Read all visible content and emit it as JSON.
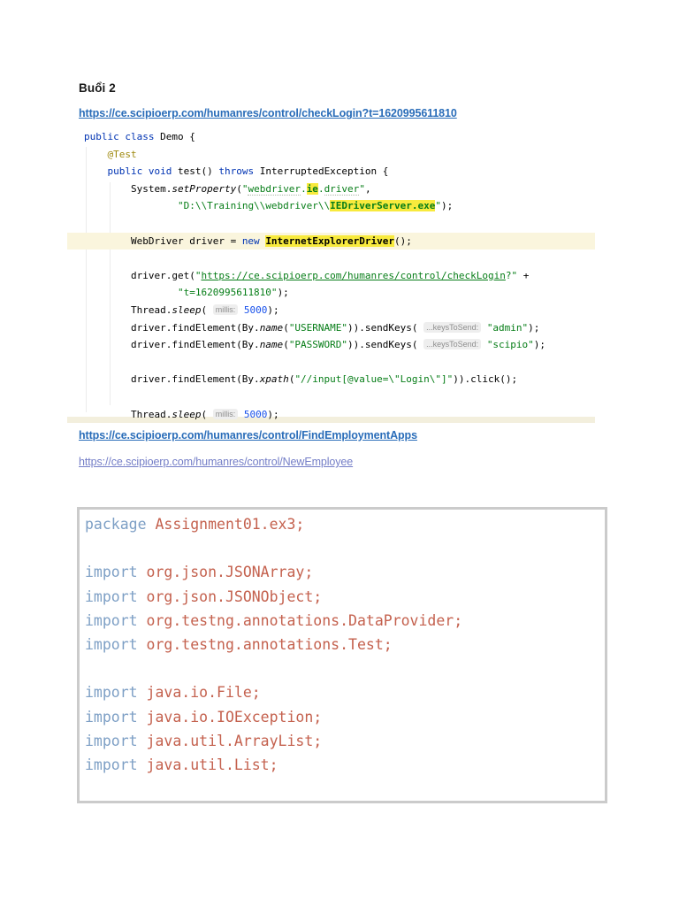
{
  "page": {
    "title": "Buổi 2",
    "links": [
      {
        "text": "https://ce.scipioerp.com/humanres/control/checkLogin?t=1620995611810"
      },
      {
        "text": "https://ce.scipioerp.com/humanres/control/FindEmploymentApps"
      },
      {
        "text": "https://ce.scipioerp.com/humanres/control/NewEmployee"
      }
    ]
  },
  "colors": {
    "link_primary": "#2a6db9",
    "link_visited": "#747ec7",
    "keyword_blue": "#0033b3",
    "string_green": "#067d17",
    "number_blue": "#1750eb",
    "annotation_olive": "#9e880d",
    "highlight_yellow": "#f8ea3d",
    "current_line_cream": "#faf5dd",
    "box_keyword_blue": "#7d9fc5",
    "box_identifier_salmon": "#c4614e",
    "box_border_gray": "#cbcbcb"
  },
  "ide_code": {
    "lines": [
      {
        "seg": [
          [
            "k",
            "public class"
          ],
          [
            "d",
            " Demo {"
          ]
        ]
      },
      {
        "seg": [
          [
            "d",
            "    "
          ],
          [
            "a",
            "@Test"
          ]
        ]
      },
      {
        "seg": [
          [
            "d",
            "    "
          ],
          [
            "k",
            "public void"
          ],
          [
            "d",
            " test() "
          ],
          [
            "k",
            "throws"
          ],
          [
            "d",
            " InterruptedException {"
          ]
        ]
      },
      {
        "seg": [
          [
            "d",
            "        System."
          ],
          [
            "m",
            "setProperty"
          ],
          [
            "d",
            "("
          ],
          [
            "s",
            "\""
          ],
          [
            "sd",
            "webdriver"
          ],
          [
            "s",
            "."
          ],
          [
            "sy",
            "ie"
          ],
          [
            "s",
            "."
          ],
          [
            "sd",
            "driver"
          ],
          [
            "s",
            "\""
          ],
          [
            "d",
            ","
          ]
        ]
      },
      {
        "seg": [
          [
            "d",
            "                "
          ],
          [
            "s",
            "\"D:\\\\Training\\\\webdriver\\\\"
          ],
          [
            "sy",
            "IEDriverServer.exe"
          ],
          [
            "s",
            "\""
          ],
          [
            "d",
            ");"
          ]
        ]
      },
      {
        "seg": []
      },
      {
        "hl": "cream",
        "seg": [
          [
            "d",
            "        WebDriver driver = "
          ],
          [
            "k",
            "new"
          ],
          [
            "d",
            " "
          ],
          [
            "dy",
            "InternetExplorerDriver"
          ],
          [
            "d",
            "();"
          ]
        ]
      },
      {
        "seg": []
      },
      {
        "seg": [
          [
            "d",
            "        driver.get("
          ],
          [
            "s",
            "\""
          ],
          [
            "su",
            "https://ce.scipioerp.com/humanres/control/checkLogin"
          ],
          [
            "s",
            "?\""
          ],
          [
            "d",
            " +"
          ]
        ]
      },
      {
        "seg": [
          [
            "d",
            "                "
          ],
          [
            "s",
            "\"t=1620995611810\""
          ],
          [
            "d",
            ");"
          ]
        ]
      },
      {
        "seg": [
          [
            "d",
            "        Thread."
          ],
          [
            "m",
            "sleep"
          ],
          [
            "d",
            "( "
          ],
          [
            "h",
            "millis:"
          ],
          [
            "d",
            " "
          ],
          [
            "n",
            "5000"
          ],
          [
            "d",
            ");"
          ]
        ]
      },
      {
        "seg": [
          [
            "d",
            "        driver.findElement(By."
          ],
          [
            "m",
            "name"
          ],
          [
            "d",
            "("
          ],
          [
            "s",
            "\"USERNAME\""
          ],
          [
            "d",
            ")).sendKeys( "
          ],
          [
            "h",
            "...keysToSend:"
          ],
          [
            "d",
            " "
          ],
          [
            "s",
            "\"admin\""
          ],
          [
            "d",
            ");"
          ]
        ]
      },
      {
        "seg": [
          [
            "d",
            "        driver.findElement(By."
          ],
          [
            "m",
            "name"
          ],
          [
            "d",
            "("
          ],
          [
            "s",
            "\"PASSWORD\""
          ],
          [
            "d",
            ")).sendKeys( "
          ],
          [
            "h",
            "...keysToSend:"
          ],
          [
            "d",
            " "
          ],
          [
            "s",
            "\"scipio\""
          ],
          [
            "d",
            ");"
          ]
        ]
      },
      {
        "seg": []
      },
      {
        "seg": [
          [
            "d",
            "        driver.findElement(By."
          ],
          [
            "m",
            "xpath"
          ],
          [
            "d",
            "("
          ],
          [
            "s",
            "\"//input[@value=\\\"Login\\\"]\""
          ],
          [
            "d",
            ")).click();"
          ]
        ]
      },
      {
        "seg": []
      },
      {
        "seg": [
          [
            "d",
            "        Thread."
          ],
          [
            "m",
            "sleep"
          ],
          [
            "d",
            "( "
          ],
          [
            "h",
            "millis:"
          ],
          [
            "d",
            " "
          ],
          [
            "n",
            "5000"
          ],
          [
            "d",
            ");"
          ]
        ]
      }
    ]
  },
  "box_code": {
    "lines": [
      {
        "seg": [
          [
            "k2",
            "package"
          ],
          [
            "r2",
            " Assignment01.ex3;"
          ]
        ]
      },
      {
        "seg": []
      },
      {
        "seg": [
          [
            "k2",
            "import"
          ],
          [
            "r2",
            " org.json.JSONArray;"
          ]
        ]
      },
      {
        "seg": [
          [
            "k2",
            "import"
          ],
          [
            "r2",
            " org.json.JSONObject;"
          ]
        ]
      },
      {
        "seg": [
          [
            "k2",
            "import"
          ],
          [
            "r2",
            " org.testng.annotations.DataProvider;"
          ]
        ]
      },
      {
        "seg": [
          [
            "k2",
            "import"
          ],
          [
            "r2",
            " org.testng.annotations.Test;"
          ]
        ]
      },
      {
        "seg": []
      },
      {
        "seg": [
          [
            "k2",
            "import"
          ],
          [
            "r2",
            " java.io.File;"
          ]
        ]
      },
      {
        "seg": [
          [
            "k2",
            "import"
          ],
          [
            "r2",
            " java.io.IOException;"
          ]
        ]
      },
      {
        "seg": [
          [
            "k2",
            "import"
          ],
          [
            "r2",
            " java.util.ArrayList;"
          ]
        ]
      },
      {
        "seg": [
          [
            "k2",
            "import"
          ],
          [
            "r2",
            " java.util.List;"
          ]
        ]
      }
    ]
  }
}
